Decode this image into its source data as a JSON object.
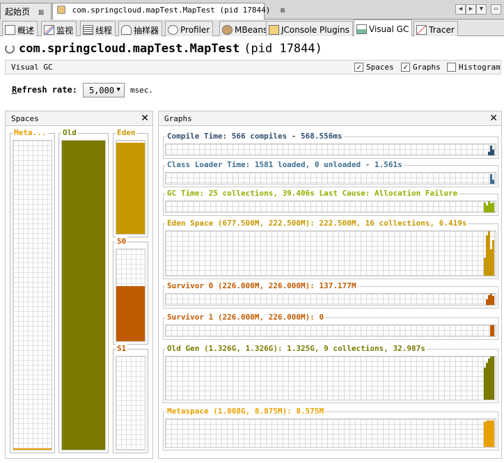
{
  "doc_tabs": [
    {
      "label": "起始页",
      "close": "⊠",
      "active": false
    },
    {
      "label": "com.springcloud.mapTest.MapTest (pid 17844)",
      "close": "⊠",
      "active": true
    }
  ],
  "nav_buttons": [
    "◀",
    "▶",
    "▼",
    "▭"
  ],
  "tool_tabs": [
    {
      "label": "概述",
      "icon": "overview-icon"
    },
    {
      "label": "监视",
      "icon": "monitor-icon"
    },
    {
      "label": "线程",
      "icon": "threads-icon"
    },
    {
      "label": "抽样器",
      "icon": "sampler-icon"
    },
    {
      "label": "Profiler",
      "icon": "profiler-icon"
    },
    {
      "label": "MBeans",
      "icon": "mbeans-icon"
    },
    {
      "label": "JConsole Plugins",
      "icon": "jconsole-icon"
    },
    {
      "label": "Visual GC",
      "icon": "visualgc-icon",
      "active": true
    },
    {
      "label": "Tracer",
      "icon": "tracer-icon"
    }
  ],
  "app": {
    "title": "com.springcloud.mapTest.MapTest",
    "pid": "(pid 17844)"
  },
  "view": {
    "label": "Visual GC",
    "spaces_label": "Spaces",
    "spaces_checked": true,
    "graphs_label": "Graphs",
    "graphs_checked": true,
    "histogram_label": "Histogram",
    "histogram_checked": false
  },
  "refresh": {
    "label_prefix": "R",
    "label_rest": "efresh rate:",
    "value": "5,000",
    "units": "msec."
  },
  "spaces_panel": {
    "title": "Spaces",
    "close": "✕",
    "spaces": [
      {
        "key": "meta",
        "label": "Meta...",
        "color": "#e8a000",
        "level": 0.008
      },
      {
        "key": "old",
        "label": "Old",
        "color": "#7a7a00",
        "level": 1.0
      },
      {
        "key": "eden",
        "label": "Eden",
        "color": "#c89600",
        "level": 0.98
      },
      {
        "key": "s0",
        "label": "S0",
        "color": "#c05a00",
        "level": 0.6
      },
      {
        "key": "s1",
        "label": "S1",
        "color": "#c05a00",
        "level": 0.0
      }
    ]
  },
  "graphs_panel": {
    "title": "Graphs",
    "close": "✕",
    "graphs": [
      {
        "key": "compile",
        "title": "Compile Time: 566 compiles - 568.556ms",
        "color": "#2f4f6f",
        "bars": [
          0.0,
          0.3,
          0.9,
          0.5
        ]
      },
      {
        "key": "classloader",
        "title": "Class Loader Time: 1581 loaded, 0 unloaded - 1.561s",
        "color": "#3d6e90",
        "bars": [
          0.0,
          0.0,
          0.9,
          0.4
        ]
      },
      {
        "key": "gctime",
        "title": "GC Time: 25 collections, 39.406s  Last Cause: Allocation Failure",
        "color": "#8fb000",
        "bars": [
          0.9,
          0.6,
          1.0,
          0.8,
          0.9
        ]
      },
      {
        "key": "eden",
        "title": "Eden Space (677.500M, 222.500M): 222.500M, 16 collections, 6.419s",
        "color": "#c89600",
        "bars": [
          0.4,
          0.9,
          1.0,
          0.6,
          0.8
        ]
      },
      {
        "key": "survivor0",
        "title": "Survivor 0 (226.000M, 226.000M): 137.177M",
        "color": "#c05a00",
        "bars": [
          0.5,
          0.9,
          1.0,
          0.8
        ]
      },
      {
        "key": "survivor1",
        "title": "Survivor 1 (226.000M, 226.000M): 0",
        "color": "#c05a00",
        "bars": [
          1.0,
          1.0
        ]
      },
      {
        "key": "oldgen",
        "title": "Old Gen (1.326G, 1.326G): 1.325G, 9 collections, 32.987s",
        "color": "#7a7a00",
        "bars": [
          0.75,
          0.85,
          0.95,
          1.0,
          1.0
        ]
      },
      {
        "key": "metaspace",
        "title": "Metaspace (1.008G, 8.875M): 8.575M",
        "color": "#e8a000",
        "bars": [
          0.9,
          0.95,
          0.95,
          0.95,
          0.95
        ]
      }
    ]
  }
}
